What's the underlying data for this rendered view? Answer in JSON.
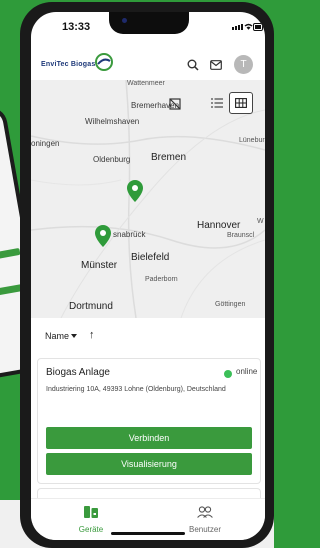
{
  "status_bar": {
    "time": "13:33"
  },
  "app_bar": {
    "logo_text": "EnviTec Biogas",
    "avatar_initial": "T"
  },
  "map": {
    "labels": {
      "wattenmeer": "Wattenmeer",
      "bremerhaven": "Bremerhaven",
      "wilhelmshaven": "Wilhelmshaven",
      "oldenburg": "Oldenburg",
      "bremen": "Bremen",
      "groningen": "oningen",
      "luneburg": "Lünebur",
      "osnabruck": "snabrück",
      "hannover": "Hannover",
      "braunschweig": "Braunscl",
      "wolfsburg": "W",
      "munster": "Münster",
      "bielefeld": "Bielefeld",
      "paderborn": "Paderborn",
      "dortmund": "Dortmund",
      "gottingen": "Göttingen"
    }
  },
  "sort": {
    "label": "Name",
    "direction_glyph": "↑"
  },
  "device_card": {
    "title": "Biogas Anlage",
    "status": "online",
    "address": "Industriering 10A, 49393 Lohne (Oldenburg), Deutschland",
    "connect_label": "Verbinden",
    "visualize_label": "Visualisierung"
  },
  "bottom_nav": {
    "devices_label": "Geräte",
    "users_label": "Benutzer"
  },
  "colors": {
    "accent": "#3a9a3d",
    "online": "#3bbf58"
  }
}
